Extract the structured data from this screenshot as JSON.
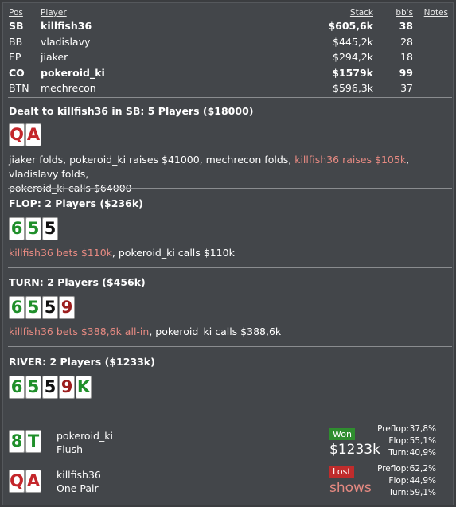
{
  "table": {
    "headers": {
      "pos": "Pos",
      "player": "Player",
      "stack": "Stack",
      "bbs": "bb's",
      "notes": "Notes"
    },
    "rows": [
      {
        "pos": "SB",
        "name": "killfish36",
        "stack": "$605,6k",
        "bbs": "38",
        "bold": true
      },
      {
        "pos": "BB",
        "name": "vladislavy",
        "stack": "$445,2k",
        "bbs": "28",
        "bold": false
      },
      {
        "pos": "EP",
        "name": "jiaker",
        "stack": "$294,2k",
        "bbs": "18",
        "bold": false
      },
      {
        "pos": "CO",
        "name": "pokeroid_ki",
        "stack": "$1579k",
        "bbs": "99",
        "bold": true
      },
      {
        "pos": "BTN",
        "name": "mechrecon",
        "stack": "$596,3k",
        "bbs": "37",
        "bold": false
      }
    ]
  },
  "preflop": {
    "title": "Dealt to killfish36 in SB: 5 Players ($18000)",
    "cards": [
      {
        "rank": "Q",
        "color": "red"
      },
      {
        "rank": "A",
        "color": "red"
      }
    ],
    "action_a": "jiaker folds, pokeroid_ki raises $41000, mechrecon folds, ",
    "action_hl": "killfish36 raises $105k",
    "action_b": ", vladislavy folds,",
    "action_c": "pokeroid_ki calls $64000"
  },
  "flop": {
    "title": "FLOP: 2 Players ($236k)",
    "cards": [
      {
        "rank": "6",
        "color": "green"
      },
      {
        "rank": "5",
        "color": "green"
      },
      {
        "rank": "5",
        "color": "black"
      }
    ],
    "action_hl": "killfish36 bets $110k",
    "action_b": ", pokeroid_ki calls $110k"
  },
  "turn": {
    "title": "TURN: 2 Players ($456k)",
    "cards": [
      {
        "rank": "6",
        "color": "green"
      },
      {
        "rank": "5",
        "color": "green"
      },
      {
        "rank": "5",
        "color": "black"
      },
      {
        "rank": "9",
        "color": "darkred"
      }
    ],
    "action_hl": "killfish36 bets $388,6k all-in",
    "action_b": ", pokeroid_ki calls $388,6k"
  },
  "river": {
    "title": "RIVER: 2 Players ($1233k)",
    "cards": [
      {
        "rank": "6",
        "color": "green"
      },
      {
        "rank": "5",
        "color": "green"
      },
      {
        "rank": "5",
        "color": "black"
      },
      {
        "rank": "9",
        "color": "darkred"
      },
      {
        "rank": "K",
        "color": "green"
      }
    ]
  },
  "results": [
    {
      "cards": [
        {
          "rank": "8",
          "color": "green"
        },
        {
          "rank": "T",
          "color": "green"
        }
      ],
      "name": "pokeroid_ki",
      "hand": "Flush",
      "status": "Won",
      "value": "$1233k",
      "equity": [
        {
          "label": "Preflop:",
          "value": "37,8%"
        },
        {
          "label": "Flop:",
          "value": "55,1%"
        },
        {
          "label": "Turn:",
          "value": "40,9%"
        }
      ]
    },
    {
      "cards": [
        {
          "rank": "Q",
          "color": "red"
        },
        {
          "rank": "A",
          "color": "red"
        }
      ],
      "name": "killfish36",
      "hand": "One Pair",
      "status": "Lost",
      "value": "shows",
      "equity": [
        {
          "label": "Preflop:",
          "value": "62,2%"
        },
        {
          "label": "Flop:",
          "value": "44,9%"
        },
        {
          "label": "Turn:",
          "value": "59,1%"
        }
      ]
    }
  ],
  "colors": {
    "background": "#43464a",
    "highlight": "#e68a82",
    "won": "#2f8d2f",
    "lost": "#c02c2c"
  }
}
